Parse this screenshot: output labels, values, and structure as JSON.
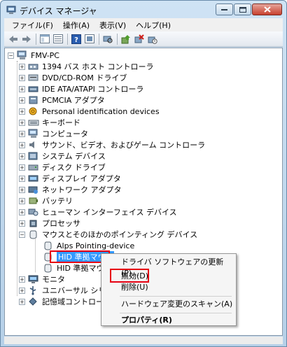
{
  "window": {
    "title": "デバイス マネージャ",
    "buttons": [
      "minimize",
      "maximize",
      "close"
    ]
  },
  "menubar": [
    {
      "label": "ファイル(F)"
    },
    {
      "label": "操作(A)"
    },
    {
      "label": "表示(V)"
    },
    {
      "label": "ヘルプ(H)"
    }
  ],
  "toolbar": {
    "icons": [
      "back-icon",
      "forward-icon",
      "properties-window-icon",
      "console-tree-icon",
      "help-icon",
      "device-list-icon",
      "scan-hardware-icon",
      "update-driver-icon",
      "uninstall-icon",
      "disable-icon"
    ]
  },
  "tree": {
    "root": "FMV-PC",
    "categories": [
      {
        "label": "1394 バス ホスト コントローラ",
        "icon": "bus-controller-icon"
      },
      {
        "label": "DVD/CD-ROM ドライブ",
        "icon": "dvd-drive-icon"
      },
      {
        "label": "IDE ATA/ATAPI コントローラ",
        "icon": "ide-controller-icon"
      },
      {
        "label": "PCMCIA アダプタ",
        "icon": "pcmcia-icon"
      },
      {
        "label": "Personal identification devices",
        "icon": "fingerprint-icon"
      },
      {
        "label": "キーボード",
        "icon": "keyboard-icon"
      },
      {
        "label": "コンピュータ",
        "icon": "computer-icon"
      },
      {
        "label": "サウンド、ビデオ、およびゲーム コントローラ",
        "icon": "sound-icon"
      },
      {
        "label": "システム デバイス",
        "icon": "system-device-icon"
      },
      {
        "label": "ディスク ドライブ",
        "icon": "disk-drive-icon"
      },
      {
        "label": "ディスプレイ アダプタ",
        "icon": "display-adapter-icon"
      },
      {
        "label": "ネットワーク アダプタ",
        "icon": "network-adapter-icon"
      },
      {
        "label": "バッテリ",
        "icon": "battery-icon"
      },
      {
        "label": "ヒューマン インターフェイス デバイス",
        "icon": "hid-icon"
      },
      {
        "label": "プロセッサ",
        "icon": "processor-icon"
      },
      {
        "label": "マウスとそのほかのポインティング デバイス",
        "icon": "mouse-icon"
      }
    ],
    "mouse_children": [
      {
        "label": "Alps Pointing-device"
      },
      {
        "label": "HID 準拠マウス",
        "selected": true
      },
      {
        "label": "HID 準拠マウス"
      }
    ],
    "after_categories": [
      {
        "label": "モニタ",
        "icon": "monitor-icon"
      },
      {
        "label": "ユニバーサル シリア",
        "icon": "usb-icon"
      },
      {
        "label": "記憶域コントローラ",
        "icon": "storage-controller-icon"
      }
    ]
  },
  "context_menu": {
    "items": [
      {
        "label": "ドライバ ソフトウェアの更新(P)..."
      },
      {
        "label": "無効(D)",
        "highlighted": true
      },
      {
        "label": "削除(U)"
      },
      {
        "label": "ハードウェア変更のスキャン(A)"
      },
      {
        "label": "プロパティ(R)",
        "bold": true
      }
    ]
  },
  "colors": {
    "selection": "#3399ff",
    "highlight_box": "#e60012"
  }
}
